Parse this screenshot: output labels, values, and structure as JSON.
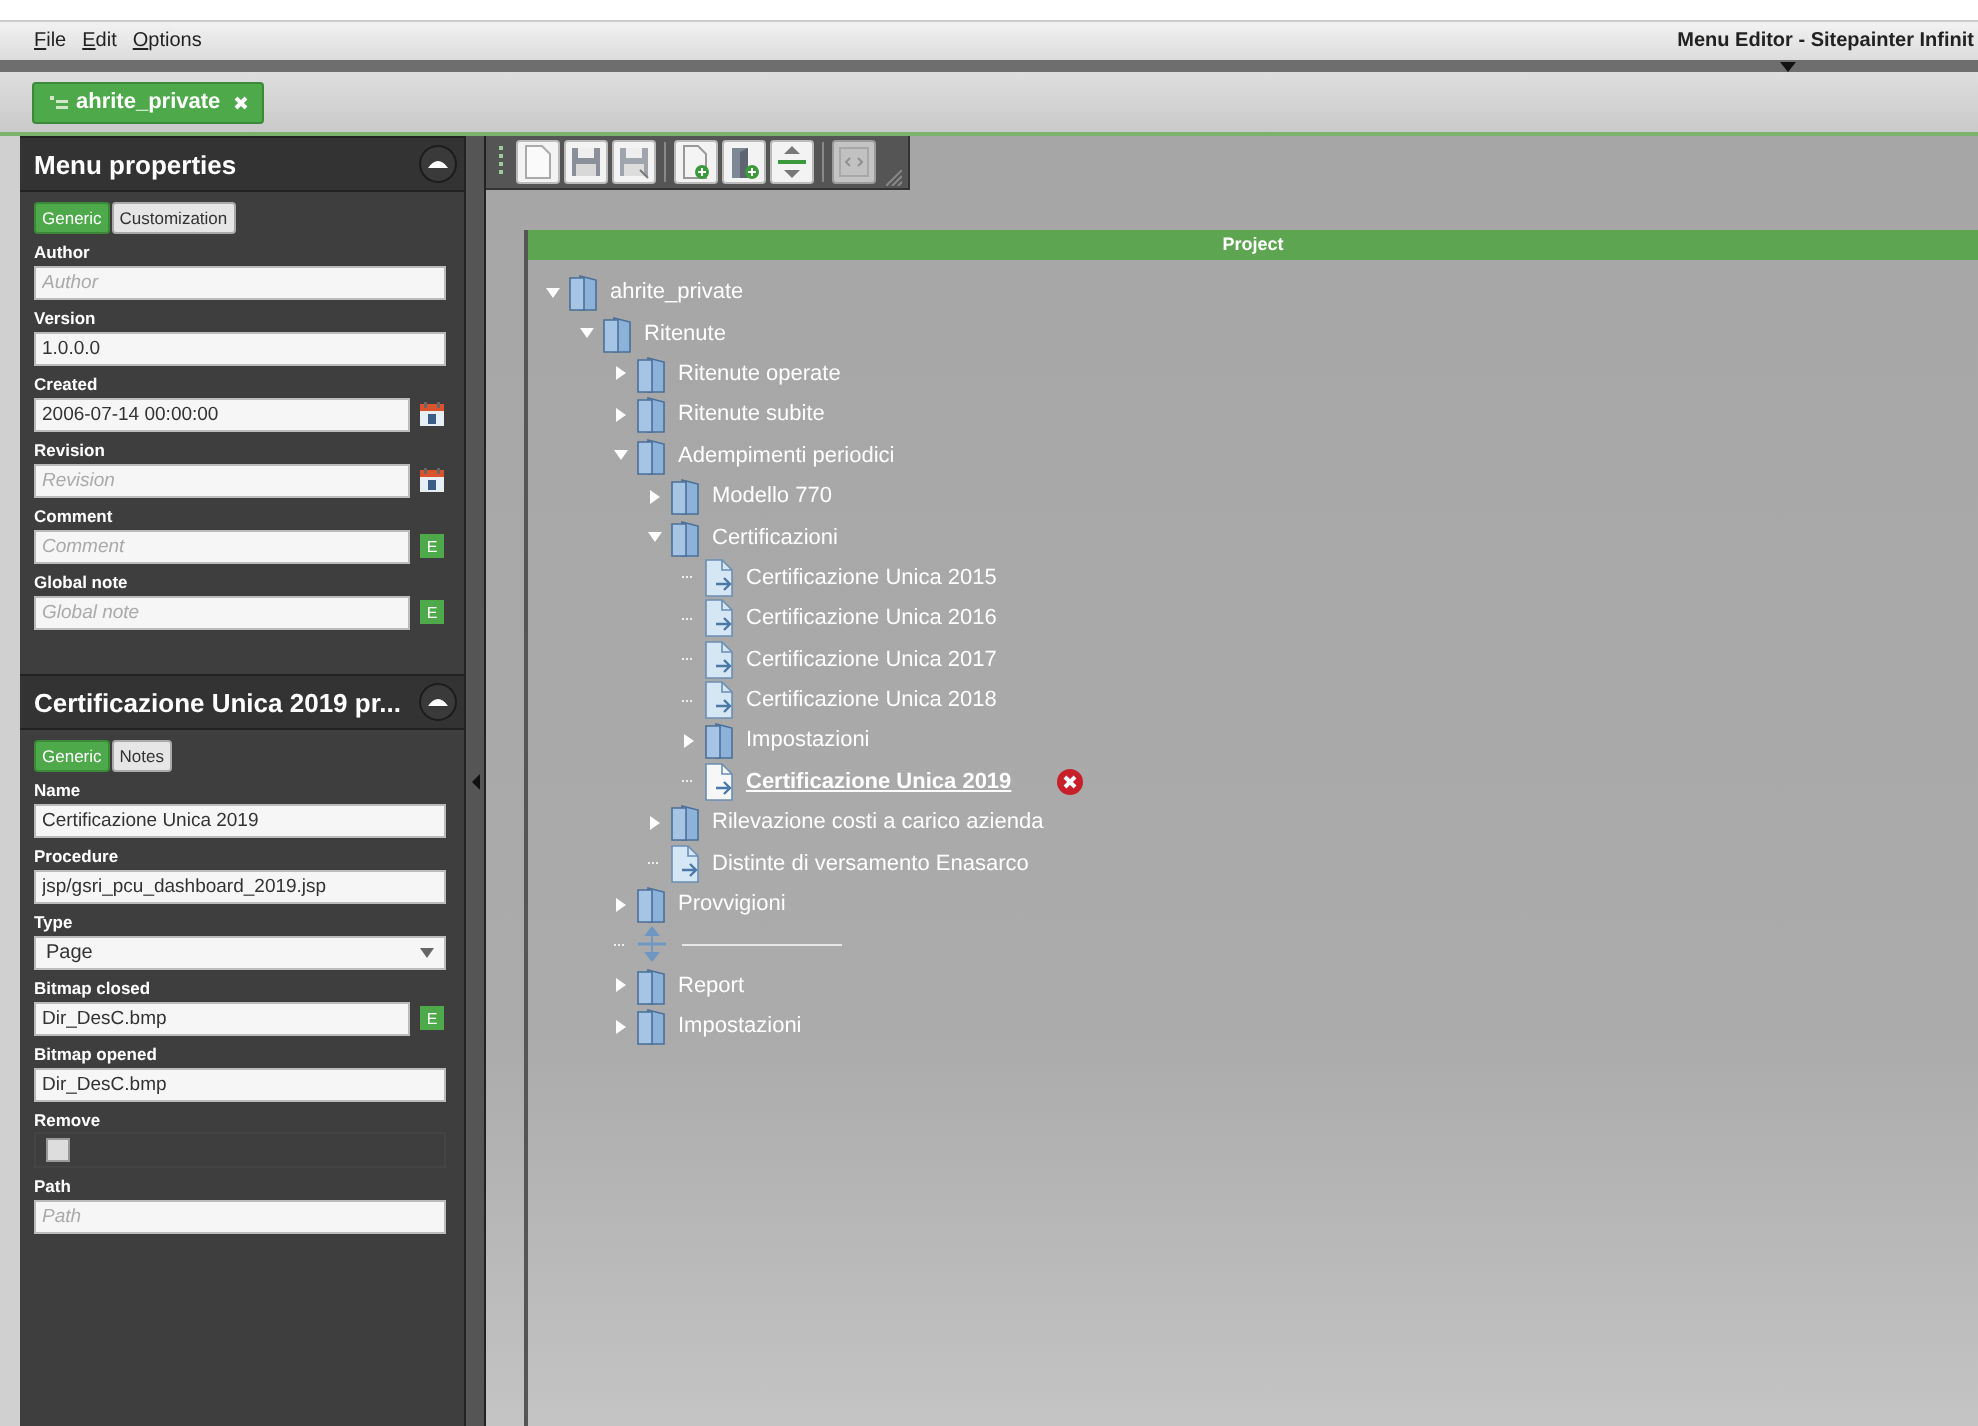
{
  "menu_bar": {
    "items": [
      {
        "label": "File"
      },
      {
        "label": "Edit"
      },
      {
        "label": "Options"
      }
    ],
    "title": "Menu Editor - Sitepainter Infinit"
  },
  "document_tabs": [
    {
      "label": "ahrite_private",
      "selected": true,
      "closable": true
    }
  ],
  "property_panels": [
    {
      "title": "Menu properties",
      "tabs": [
        {
          "label": "Generic",
          "selected": true
        },
        {
          "label": "Customization",
          "selected": false
        }
      ],
      "fields": [
        {
          "kind": "text",
          "label": "Author",
          "placeholder": "Author"
        },
        {
          "kind": "text",
          "label": "Version",
          "value": "1.0.0.0"
        },
        {
          "kind": "text",
          "label": "Created",
          "value": "2006-07-14 00:00:00",
          "action": {
            "kind": "calendar"
          }
        },
        {
          "kind": "text",
          "label": "Revision",
          "placeholder": "Revision",
          "action": {
            "kind": "calendar"
          }
        },
        {
          "kind": "text",
          "label": "Comment",
          "placeholder": "Comment",
          "action": {
            "kind": "edit",
            "label": "E"
          }
        },
        {
          "kind": "text",
          "label": "Global note",
          "placeholder": "Global note",
          "action": {
            "kind": "edit",
            "label": "E"
          }
        }
      ]
    },
    {
      "title": "Certificazione Unica 2019 pr...",
      "tabs": [
        {
          "label": "Generic",
          "selected": true
        },
        {
          "label": "Notes",
          "selected": false
        }
      ],
      "fields": [
        {
          "kind": "text",
          "label": "Name",
          "value": "Certificazione Unica 2019"
        },
        {
          "kind": "text",
          "label": "Procedure",
          "value": "jsp/gsri_pcu_dashboard_2019.jsp"
        },
        {
          "kind": "select",
          "label": "Type",
          "value": "Page"
        },
        {
          "kind": "text",
          "label": "Bitmap closed",
          "value": "Dir_DesC.bmp",
          "action": {
            "kind": "edit",
            "label": "E"
          }
        },
        {
          "kind": "text",
          "label": "Bitmap opened",
          "value": "Dir_DesC.bmp"
        },
        {
          "kind": "checkbox",
          "label": "Remove",
          "checked": false
        },
        {
          "kind": "text",
          "label": "Path",
          "placeholder": "Path"
        }
      ]
    }
  ],
  "toolbar": {
    "groups": [
      {
        "buttons": [
          {
            "kind": "new"
          },
          {
            "kind": "save"
          },
          {
            "kind": "save-as"
          }
        ]
      },
      {
        "buttons": [
          {
            "kind": "add-page"
          },
          {
            "kind": "add-folder"
          },
          {
            "kind": "add-separator"
          }
        ]
      },
      {
        "buttons": [
          {
            "kind": "code"
          }
        ]
      }
    ]
  },
  "project": {
    "title": "Project",
    "tree": [
      {
        "kind": "folder",
        "label": "ahrite_private",
        "expanded": true,
        "children": [
          {
            "kind": "folder",
            "label": "Ritenute",
            "expanded": true,
            "children": [
              {
                "kind": "folder",
                "label": "Ritenute operate",
                "expanded": false
              },
              {
                "kind": "folder",
                "label": "Ritenute subite",
                "expanded": false
              },
              {
                "kind": "folder",
                "label": "Adempimenti periodici",
                "expanded": true,
                "children": [
                  {
                    "kind": "folder",
                    "label": "Modello 770",
                    "expanded": false
                  },
                  {
                    "kind": "folder",
                    "label": "Certificazioni",
                    "expanded": true,
                    "children": [
                      {
                        "kind": "page",
                        "label": "Certificazione Unica 2015",
                        "selected": false
                      },
                      {
                        "kind": "page",
                        "label": "Certificazione Unica 2016",
                        "selected": false
                      },
                      {
                        "kind": "page",
                        "label": "Certificazione Unica 2017",
                        "selected": false
                      },
                      {
                        "kind": "page",
                        "label": "Certificazione Unica 2018",
                        "selected": false
                      },
                      {
                        "kind": "folder",
                        "label": "Impostazioni",
                        "expanded": false
                      },
                      {
                        "kind": "page",
                        "label": "Certificazione Unica 2019",
                        "selected": true
                      }
                    ]
                  },
                  {
                    "kind": "folder",
                    "label": "Rilevazione costi a carico azienda",
                    "expanded": false
                  },
                  {
                    "kind": "page",
                    "label": "Distinte di versamento Enasarco",
                    "selected": false
                  }
                ]
              },
              {
                "kind": "folder",
                "label": "Provvigioni",
                "expanded": false
              },
              {
                "kind": "separator"
              },
              {
                "kind": "folder",
                "label": "Report",
                "expanded": false
              },
              {
                "kind": "folder",
                "label": "Impostazioni",
                "expanded": false
              }
            ]
          }
        ]
      }
    ]
  }
}
